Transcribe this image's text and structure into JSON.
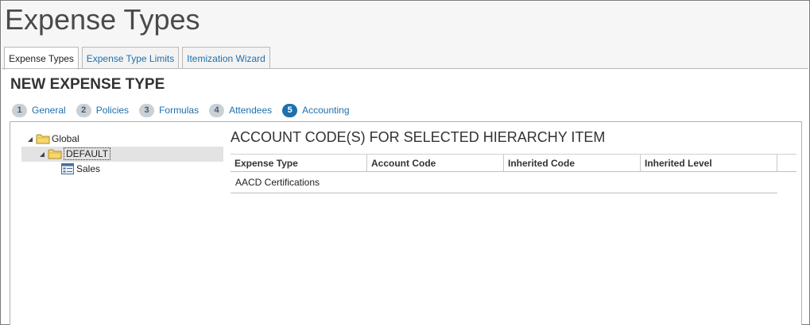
{
  "page": {
    "title": "Expense Types"
  },
  "tabs": [
    {
      "label": "Expense Types",
      "active": true
    },
    {
      "label": "Expense Type Limits",
      "active": false
    },
    {
      "label": "Itemization Wizard",
      "active": false
    }
  ],
  "form": {
    "title": "NEW EXPENSE TYPE"
  },
  "steps": [
    {
      "number": "1",
      "label": "General"
    },
    {
      "number": "2",
      "label": "Policies"
    },
    {
      "number": "3",
      "label": "Formulas"
    },
    {
      "number": "4",
      "label": "Attendees"
    },
    {
      "number": "5",
      "label": "Accounting",
      "active": true
    }
  ],
  "tree": {
    "nodes": [
      {
        "label": "Global",
        "icon": "folder-icon",
        "expanded": true
      },
      {
        "label": "DEFAULT",
        "icon": "folder-icon",
        "expanded": true,
        "selected": true
      },
      {
        "label": "Sales",
        "icon": "document-list-icon"
      }
    ]
  },
  "content": {
    "title": "ACCOUNT CODE(S) FOR SELECTED HIERARCHY ITEM",
    "columns": [
      "Expense Type",
      "Account Code",
      "Inherited Code",
      "Inherited Level"
    ],
    "rows": [
      [
        "AACD Certifications",
        "",
        "",
        ""
      ]
    ]
  },
  "colors": {
    "link": "#1f6fad",
    "active_step": "#1f6fad",
    "inactive_step": "#c9d0d6",
    "folder": "#f5d76e"
  }
}
